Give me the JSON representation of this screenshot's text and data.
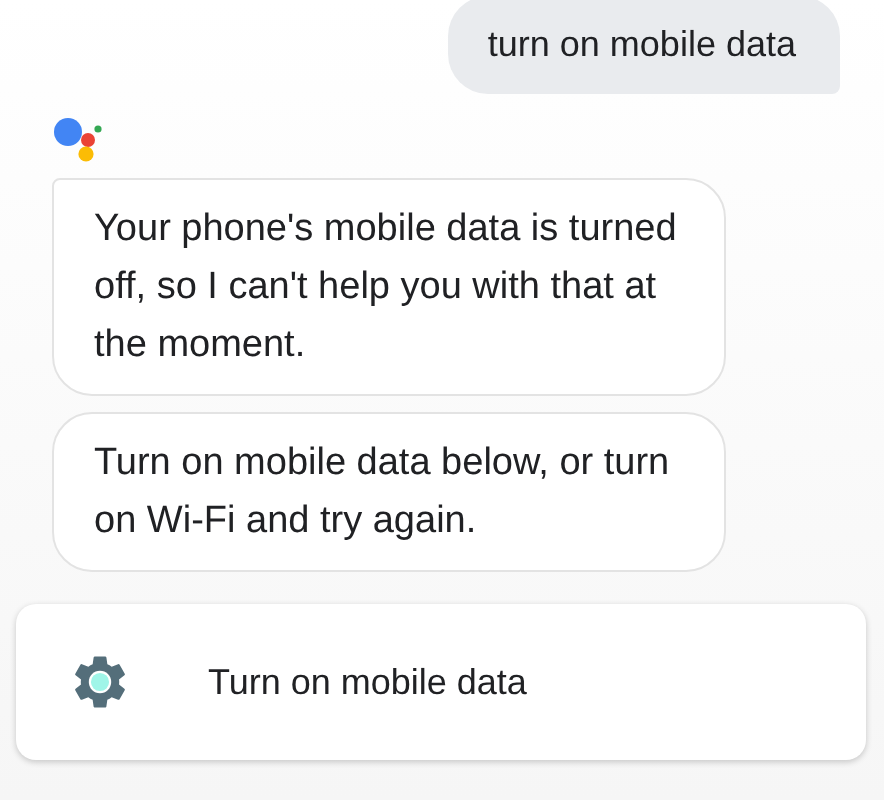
{
  "user_message": "turn on mobile data",
  "assistant_messages": [
    "Your phone's mobile data is turned off, so I can't help you with that at the moment.",
    "Turn on mobile data below, or turn on Wi-Fi and try again."
  ],
  "action": {
    "label": "Turn on mobile data"
  }
}
